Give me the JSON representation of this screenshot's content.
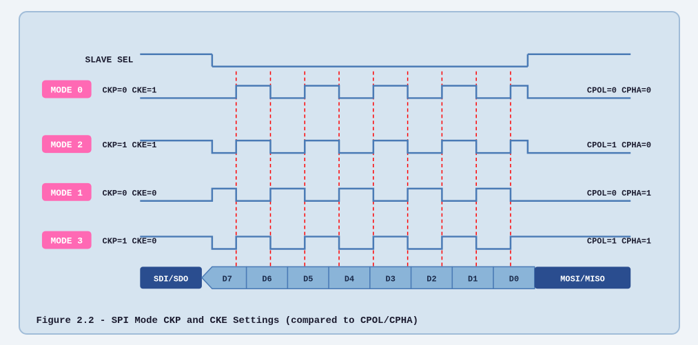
{
  "caption": "Figure 2.2 - SPI Mode CKP and CKE Settings (compared to CPOL/CPHA)",
  "diagram": {
    "slave_sel_label": "SLAVE SEL",
    "modes": [
      {
        "label": "MODE 0",
        "params": "CKP=0  CKE=1",
        "right": "CPOL=0  CPHA=0"
      },
      {
        "label": "MODE 2",
        "params": "CKP=1  CKE=1",
        "right": "CPOL=1  CPHA=0"
      },
      {
        "label": "MODE 1",
        "params": "CKP=0  CKE=0",
        "right": "CPOL=0  CPHA=1"
      },
      {
        "label": "MODE 3",
        "params": "CKP=1  CKE=0",
        "right": "CPOL=1  CPHA=1"
      }
    ],
    "data_bits": [
      "SDI/SDO",
      "D7",
      "D6",
      "D5",
      "D4",
      "D3",
      "D2",
      "D1",
      "D0",
      "MOSI/MISO"
    ]
  }
}
